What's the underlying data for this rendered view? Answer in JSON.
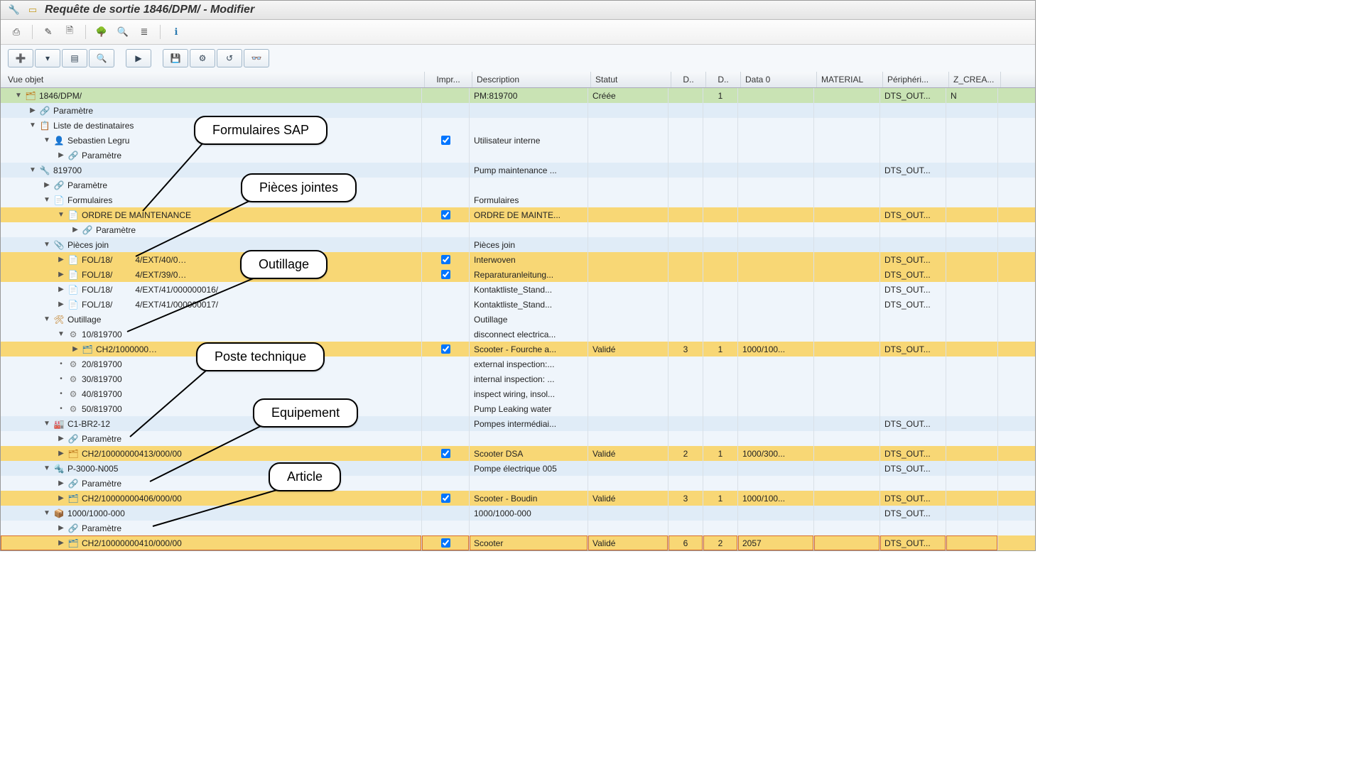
{
  "window": {
    "title": "Requête de sortie 1846/DPM/ - Modifier"
  },
  "toolbar1": {
    "print": "⎙",
    "edit": "✎",
    "new": "🗎",
    "tree": "🌳",
    "find": "🔍",
    "stack": "≣",
    "info": "ℹ"
  },
  "toolbar2": {
    "b1": "➕",
    "b2": "▤",
    "b3": "🔍",
    "b4": "▶",
    "b5": "💾",
    "b6": "⚙",
    "b7": "↺",
    "b8": "👓"
  },
  "columns": {
    "tree": "Vue objet",
    "impr": "Impr...",
    "desc": "Description",
    "stat": "Statut",
    "d1": "D..",
    "d2": "D..",
    "data0": "Data 0",
    "mat": "MATERIAL",
    "peri": "Périphéri...",
    "zc": "Z_CREA..."
  },
  "callouts": {
    "sap_forms": "Formulaires SAP",
    "attachments": "Pièces jointes",
    "tools": "Outillage",
    "funcloc": "Poste technique",
    "equipment": "Equipement",
    "material": "Article"
  },
  "rows": [
    {
      "id": "r0",
      "indent": 0,
      "arrow": "▼",
      "icon": "🗂",
      "iconColor": "#c07b1e",
      "label": "1846/DPM/",
      "bg": "green",
      "desc": "PM:819700",
      "stat": "Créée",
      "d2": "1",
      "peri": "DTS_OUT...",
      "zc": "N"
    },
    {
      "id": "r1",
      "indent": 1,
      "arrow": "▶",
      "icon": "🔗",
      "iconColor": "#2a7ab0",
      "label": "Paramètre",
      "bg": "blue"
    },
    {
      "id": "r2",
      "indent": 1,
      "arrow": "▼",
      "icon": "📋",
      "iconColor": "#2a7ab0",
      "label": "Liste de destinataires",
      "bg": "light"
    },
    {
      "id": "r3",
      "indent": 2,
      "arrow": "▼",
      "icon": "👤",
      "iconColor": "#3f8f3f",
      "label": "Sebastien Legru",
      "bg": "light",
      "impr": true,
      "desc": "Utilisateur interne"
    },
    {
      "id": "r4",
      "indent": 3,
      "arrow": "▶",
      "icon": "🔗",
      "iconColor": "#2a7ab0",
      "label": "Paramètre",
      "bg": "light"
    },
    {
      "id": "r5",
      "indent": 1,
      "arrow": "▼",
      "icon": "🔧",
      "iconColor": "#2a7ab0",
      "label": "819700",
      "bg": "blue",
      "desc": "Pump maintenance ...",
      "peri": "DTS_OUT..."
    },
    {
      "id": "r6",
      "indent": 2,
      "arrow": "▶",
      "icon": "🔗",
      "iconColor": "#2a7ab0",
      "label": "Paramètre",
      "bg": "light"
    },
    {
      "id": "r7",
      "indent": 2,
      "arrow": "▼",
      "icon": "📄",
      "iconColor": "#555",
      "label": "Formulaires",
      "bg": "light",
      "desc": "Formulaires"
    },
    {
      "id": "r8",
      "indent": 3,
      "arrow": "▼",
      "icon": "📄",
      "iconColor": "#c07b1e",
      "label": "ORDRE DE MAINTENANCE",
      "bg": "yel",
      "impr": true,
      "desc": "ORDRE DE MAINTE...",
      "peri": "DTS_OUT..."
    },
    {
      "id": "r9",
      "indent": 4,
      "arrow": "▶",
      "icon": "🔗",
      "iconColor": "#2a7ab0",
      "label": "Paramètre",
      "bg": "light"
    },
    {
      "id": "r10",
      "indent": 2,
      "arrow": "▼",
      "icon": "📎",
      "iconColor": "#c07b1e",
      "label": "Pièces join",
      "bg": "blue",
      "desc": "Pièces join"
    },
    {
      "id": "r11",
      "indent": 3,
      "arrow": "▶",
      "icon": "📄",
      "iconColor": "#c07b1e",
      "label": "FOL/18/",
      "label2": "4/EXT/40/0…",
      "bg": "yel",
      "impr": true,
      "desc": "Interwoven",
      "peri": "DTS_OUT..."
    },
    {
      "id": "r12",
      "indent": 3,
      "arrow": "▶",
      "icon": "📄",
      "iconColor": "#c07b1e",
      "label": "FOL/18/",
      "label2": "4/EXT/39/0…",
      "bg": "yel",
      "impr": true,
      "desc": "Reparaturanleitung...",
      "peri": "DTS_OUT..."
    },
    {
      "id": "r13",
      "indent": 3,
      "arrow": "▶",
      "icon": "📄",
      "iconColor": "#c07b1e",
      "label": "FOL/18/",
      "label2": "4/EXT/41/000000016/",
      "bg": "light",
      "desc": "Kontaktliste_Stand...",
      "peri": "DTS_OUT..."
    },
    {
      "id": "r14",
      "indent": 3,
      "arrow": "▶",
      "icon": "📄",
      "iconColor": "#c07b1e",
      "label": "FOL/18/",
      "label2": "4/EXT/41/000000017/",
      "bg": "light",
      "desc": "Kontaktliste_Stand...",
      "peri": "DTS_OUT..."
    },
    {
      "id": "r15",
      "indent": 2,
      "arrow": "▼",
      "icon": "🛠",
      "iconColor": "#c07b1e",
      "label": "Outillage",
      "bg": "light",
      "desc": "Outillage"
    },
    {
      "id": "r16",
      "indent": 3,
      "arrow": "▼",
      "icon": "⚙",
      "iconColor": "#777",
      "label": "10/819700",
      "bg": "light",
      "desc": "disconnect electrica..."
    },
    {
      "id": "r17",
      "indent": 4,
      "arrow": "▶",
      "icon": "🗂",
      "iconColor": "#2a7ab0",
      "label": "CH2/1000000…",
      "bg": "yel",
      "impr": true,
      "desc": "Scooter - Fourche a...",
      "stat": "Validé",
      "d1": "3",
      "d2": "1",
      "data0": "1000/100...",
      "peri": "DTS_OUT..."
    },
    {
      "id": "r18",
      "indent": 3,
      "arrow": "•",
      "icon": "⚙",
      "iconColor": "#777",
      "label": "20/819700",
      "bg": "light",
      "desc": "external inspection:..."
    },
    {
      "id": "r19",
      "indent": 3,
      "arrow": "•",
      "icon": "⚙",
      "iconColor": "#777",
      "label": "30/819700",
      "bg": "light",
      "desc": "internal inspection: ..."
    },
    {
      "id": "r20",
      "indent": 3,
      "arrow": "•",
      "icon": "⚙",
      "iconColor": "#777",
      "label": "40/819700",
      "bg": "light",
      "desc": "inspect wiring, insol..."
    },
    {
      "id": "r21",
      "indent": 3,
      "arrow": "•",
      "icon": "⚙",
      "iconColor": "#777",
      "label": "50/819700",
      "bg": "light",
      "desc": "Pump Leaking water"
    },
    {
      "id": "r22",
      "indent": 2,
      "arrow": "▼",
      "icon": "🏭",
      "iconColor": "#2a7ab0",
      "label": "C1-BR2-12",
      "bg": "blue",
      "desc": "Pompes intermédiai...",
      "peri": "DTS_OUT..."
    },
    {
      "id": "r23",
      "indent": 3,
      "arrow": "▶",
      "icon": "🔗",
      "iconColor": "#2a7ab0",
      "label": "Paramètre",
      "bg": "light"
    },
    {
      "id": "r24",
      "indent": 3,
      "arrow": "▶",
      "icon": "🗂",
      "iconColor": "#c07b1e",
      "label": "CH2/10000000413/000/00",
      "bg": "yel",
      "impr": true,
      "desc": "Scooter DSA",
      "stat": "Validé",
      "d1": "2",
      "d2": "1",
      "data0": "1000/300...",
      "peri": "DTS_OUT..."
    },
    {
      "id": "r25",
      "indent": 2,
      "arrow": "▼",
      "icon": "🔩",
      "iconColor": "#2a7ab0",
      "label": "P-3000-N005",
      "bg": "blue",
      "desc": "Pompe électrique 005",
      "peri": "DTS_OUT..."
    },
    {
      "id": "r26",
      "indent": 3,
      "arrow": "▶",
      "icon": "🔗",
      "iconColor": "#2a7ab0",
      "label": "Paramètre",
      "bg": "light"
    },
    {
      "id": "r27",
      "indent": 3,
      "arrow": "▶",
      "icon": "🗂",
      "iconColor": "#2a7ab0",
      "label": "CH2/10000000406/000/00",
      "bg": "yel",
      "impr": true,
      "desc": "Scooter - Boudin",
      "stat": "Validé",
      "d1": "3",
      "d2": "1",
      "data0": "1000/100...",
      "peri": "DTS_OUT..."
    },
    {
      "id": "r28",
      "indent": 2,
      "arrow": "▼",
      "icon": "📦",
      "iconColor": "#c07b1e",
      "label": "1000/1000-000",
      "bg": "blue",
      "desc": "1000/1000-000",
      "peri": "DTS_OUT..."
    },
    {
      "id": "r29",
      "indent": 3,
      "arrow": "▶",
      "icon": "🔗",
      "iconColor": "#2a7ab0",
      "label": "Paramètre",
      "bg": "light"
    },
    {
      "id": "r30",
      "indent": 3,
      "arrow": "▶",
      "icon": "🗂",
      "iconColor": "#2a7ab0",
      "label": "CH2/10000000410/000/00",
      "bg": "yel",
      "impr": true,
      "desc": "Scooter",
      "stat": "Validé",
      "d1": "6",
      "d2": "2",
      "data0": "2057",
      "peri": "DTS_OUT...",
      "dashed": true
    }
  ]
}
